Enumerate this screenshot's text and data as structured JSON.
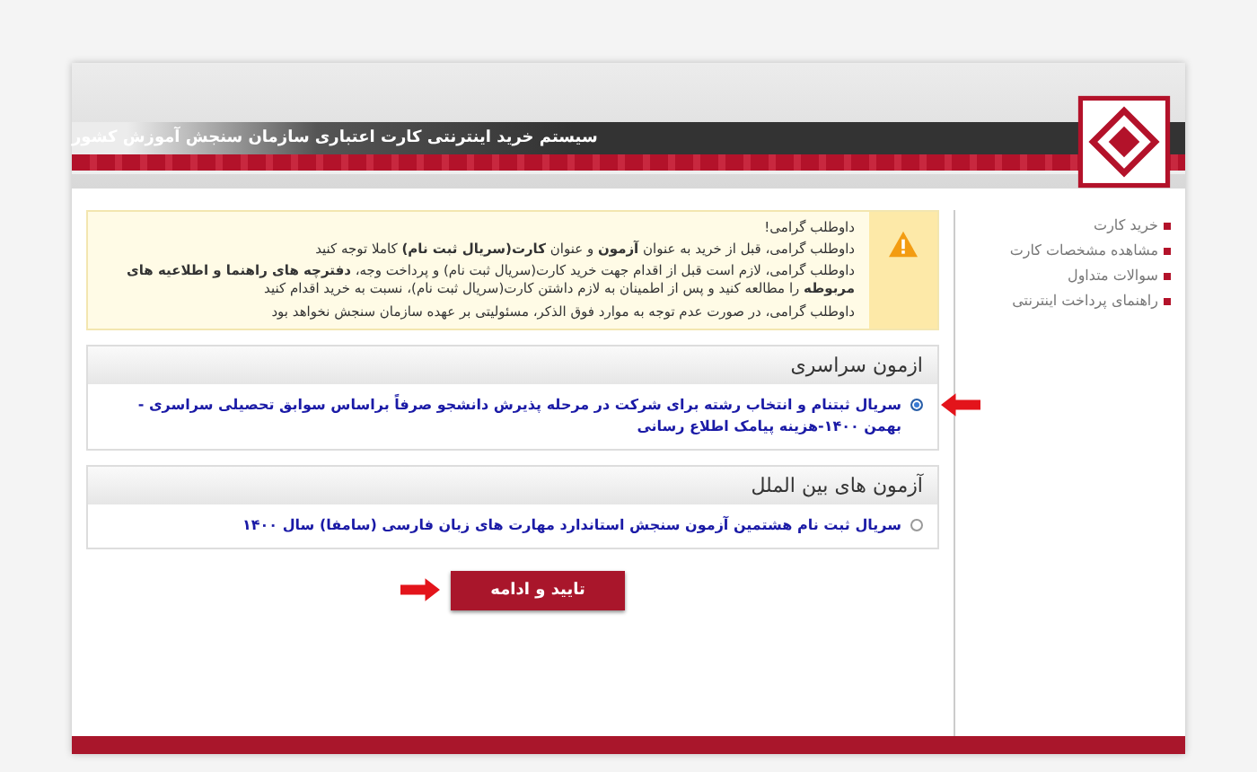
{
  "header": {
    "title": "سیستم خرید اینترنتی کارت اعتباری سازمان سنجش آموزش کشور"
  },
  "sidebar": {
    "items": [
      {
        "label": "خرید کارت"
      },
      {
        "label": "مشاهده مشخصات کارت"
      },
      {
        "label": "سوالات متداول"
      },
      {
        "label": "راهنمای پرداخت اینترنتی"
      }
    ]
  },
  "notice": {
    "title": "داوطلب گرامی!",
    "lines": [
      "داوطلب گرامی، قبل از خرید به عنوان **آزمون** و عنوان **کارت(سریال ثبت نام)** کاملا توجه کنید",
      "داوطلب گرامی، لازم است قبل از اقدام جهت خرید کارت(سریال ثبت نام) و پرداخت وجه، **دفترچه های راهنما و اطلاعیه های مربوطه** را مطالعه کنید و پس از اطمینان به لازم داشتن کارت(سریال ثبت نام)، نسبت به خرید اقدام کنید",
      "داوطلب گرامی، در صورت عدم توجه به موارد فوق الذکر، مسئولیتی بر عهده سازمان سنجش نخواهد بود"
    ]
  },
  "sections": [
    {
      "title": "ازمون سراسری",
      "options": [
        {
          "label": "سریال ثبتنام و انتخاب رشته برای شرکت در مرحله پذیرش دانشجو صرفاً براساس سوابق تحصیلی سراسری - بهمن ۱۴۰۰-هزینه پیامک اطلاع رسانی",
          "selected": true,
          "arrow": true
        }
      ]
    },
    {
      "title": "آزمون های بین الملل",
      "options": [
        {
          "label": "سریال ثبت نام هشتمین آزمون سنجش استاندارد مهارت های زبان فارسی (سامفا) سال ۱۴۰۰",
          "selected": false,
          "arrow": false
        }
      ]
    }
  ],
  "submit": {
    "label": "تایید و ادامه",
    "arrow": true
  }
}
